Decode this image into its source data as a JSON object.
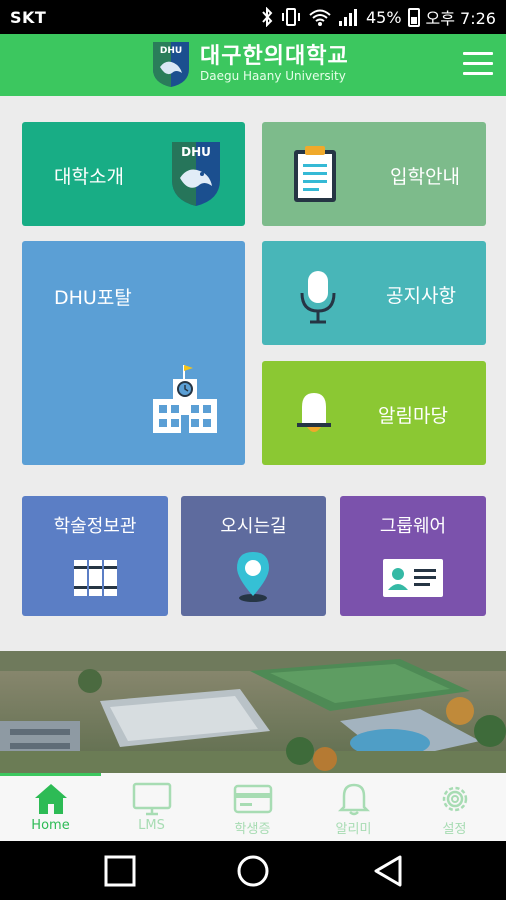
{
  "status_bar": {
    "carrier": "SKT",
    "battery_percent": "45%",
    "time": "오후 7:26"
  },
  "header": {
    "logo_badge": "DHU",
    "title": "대구한의대학교",
    "subtitle": "Daegu Haany University"
  },
  "tiles": {
    "intro": "대학소개",
    "admission": "입학안내",
    "portal": "DHU포탈",
    "notice": "공지사항",
    "alarm": "알림마당",
    "library": "학술정보관",
    "directions": "오시는길",
    "groupware": "그룹웨어"
  },
  "tabs": [
    {
      "label": "Home",
      "icon": "home-icon",
      "active": true
    },
    {
      "label": "LMS",
      "icon": "monitor-icon",
      "active": false
    },
    {
      "label": "학생증",
      "icon": "card-icon",
      "active": false
    },
    {
      "label": "알리미",
      "icon": "bell-icon",
      "active": false
    },
    {
      "label": "설정",
      "icon": "gear-icon",
      "active": false
    }
  ],
  "colors": {
    "header_green": "#3cc75f",
    "tile_intro": "#18ad85",
    "tile_admission": "#7dbb8b",
    "tile_portal": "#5b9fd5",
    "tile_notice": "#48b6b8",
    "tile_alarm": "#8bc833",
    "tile_library": "#5b7ec5",
    "tile_directions": "#5e6b9e",
    "tile_groupware": "#7b52ac"
  }
}
